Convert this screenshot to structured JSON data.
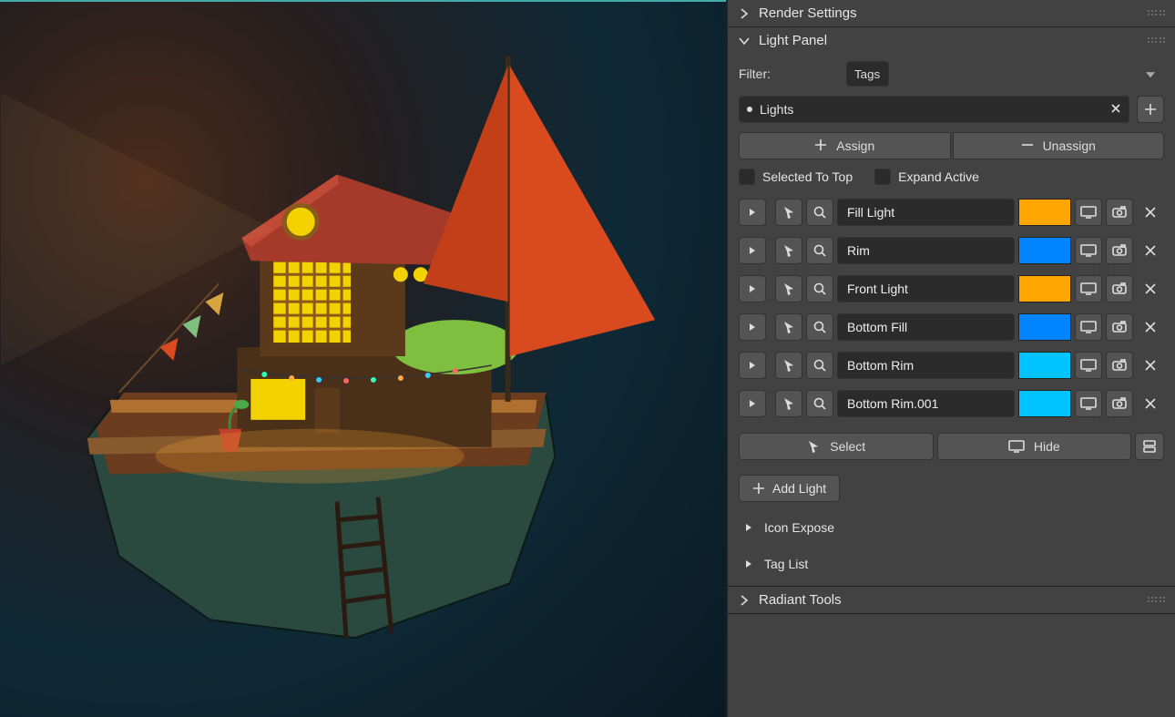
{
  "panels": {
    "render_settings": {
      "title": "Render Settings",
      "expanded": false
    },
    "light_panel": {
      "title": "Light Panel",
      "expanded": true
    },
    "radiant_tools": {
      "title": "Radiant Tools",
      "expanded": false
    }
  },
  "filter": {
    "label": "Filter:",
    "mode": "Tags"
  },
  "tag_chip": {
    "label": "Lights"
  },
  "assign": {
    "assign_label": "Assign",
    "unassign_label": "Unassign"
  },
  "options": {
    "selected_to_top": "Selected To Top",
    "expand_active": "Expand Active"
  },
  "lights": [
    {
      "name": "Fill Light",
      "color": "#ffa500"
    },
    {
      "name": "Rim",
      "color": "#0084ff"
    },
    {
      "name": "Front Light",
      "color": "#ffa500"
    },
    {
      "name": "Bottom Fill",
      "color": "#0084ff"
    },
    {
      "name": "Bottom Rim",
      "color": "#00c4ff"
    },
    {
      "name": "Bottom Rim.001",
      "color": "#00c4ff"
    }
  ],
  "actions": {
    "select": "Select",
    "hide": "Hide",
    "add_light": "Add Light"
  },
  "subsections": {
    "icon_expose": "Icon Expose",
    "tag_list": "Tag List"
  }
}
